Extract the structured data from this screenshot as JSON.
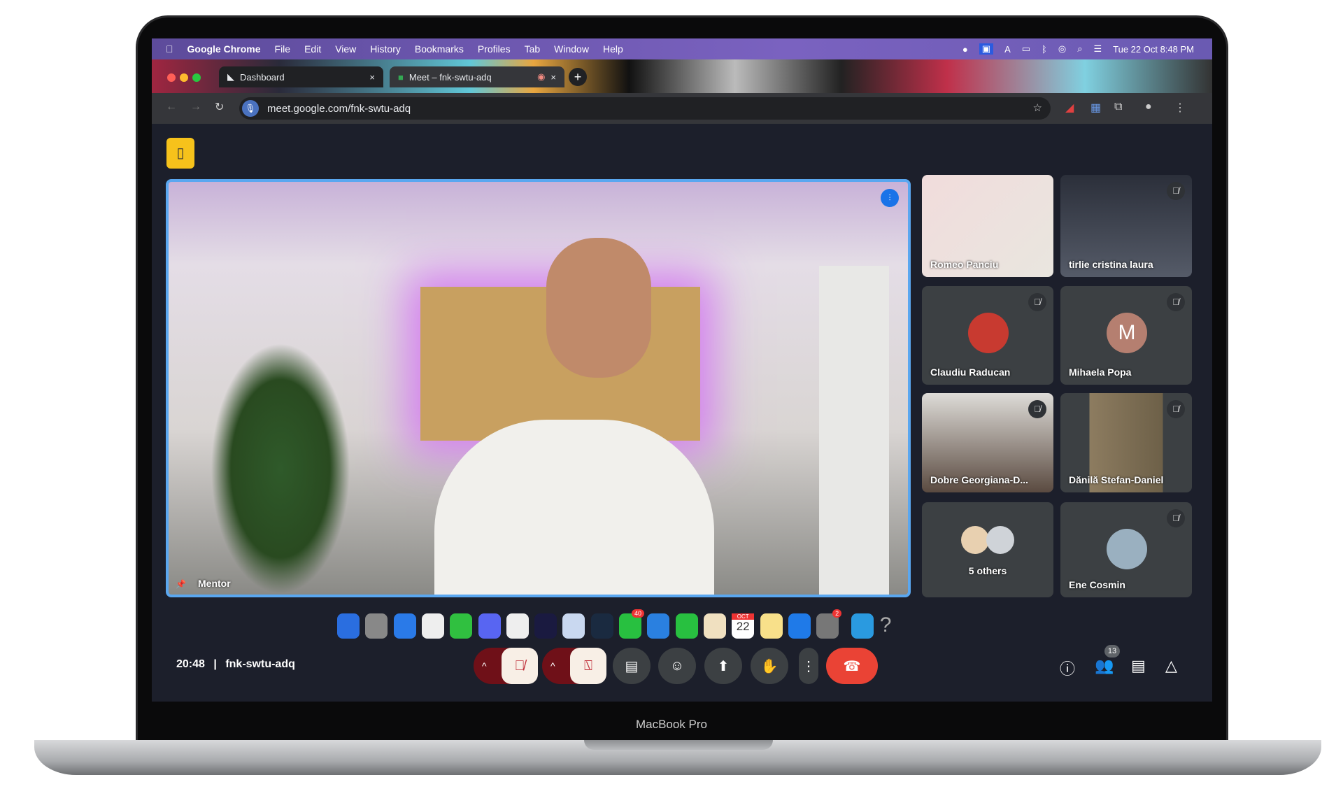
{
  "device": {
    "label": "MacBook Pro"
  },
  "menubar": {
    "items": [
      "Google Chrome",
      "File",
      "Edit",
      "View",
      "History",
      "Bookmarks",
      "Profiles",
      "Tab",
      "Window",
      "Help"
    ],
    "clock": "Tue 22 Oct  8:48 PM"
  },
  "tabs": [
    {
      "label": "Dashboard",
      "close": "×"
    },
    {
      "label": "Meet – fnk-swtu-adq",
      "close": "×"
    }
  ],
  "new_tab": "+",
  "address": {
    "url": "meet.google.com/fnk-swtu-adq"
  },
  "meet": {
    "main": {
      "name": "Mentor"
    },
    "participants": [
      {
        "name": "Romeo Panciu",
        "type": "video",
        "muted": false
      },
      {
        "name": "tirlie cristina laura",
        "type": "video",
        "muted": true
      },
      {
        "name": "Claudiu Raducan",
        "type": "photo",
        "muted": true
      },
      {
        "name": "Mihaela Popa",
        "type": "initial",
        "initial": "M",
        "color": "#b57f70",
        "muted": true
      },
      {
        "name": "Dobre Georgiana-D...",
        "type": "video",
        "muted": true
      },
      {
        "name": "Dănilă Stefan-Daniel",
        "type": "video",
        "muted": true
      },
      {
        "name": "5 others",
        "type": "group"
      },
      {
        "name": "Ene Cosmin",
        "type": "photo",
        "muted": true
      }
    ],
    "time": "20:48",
    "separator": "|",
    "code": "fnk-swtu-adq",
    "people_count": "13",
    "colors": {
      "accent": "#5aa7f0",
      "end_call": "#ea4335",
      "muted_dark": "#6f1018"
    }
  },
  "dock": {
    "apps": [
      "Finder",
      "Launchpad",
      "Safari",
      "Chrome",
      "Messages",
      "Discord",
      "CapCut",
      "Premiere Pro",
      "Photoshop",
      "Lightroom Classic",
      "WhatsApp",
      "Mail",
      "FaceTime",
      "Photos",
      "Calendar",
      "Notes",
      "App Store",
      "System Settings",
      "Files",
      "Help"
    ],
    "calendar_day": "22",
    "calendar_month": "OCT",
    "whatsapp_badge": "40",
    "settings_badge": "2"
  }
}
